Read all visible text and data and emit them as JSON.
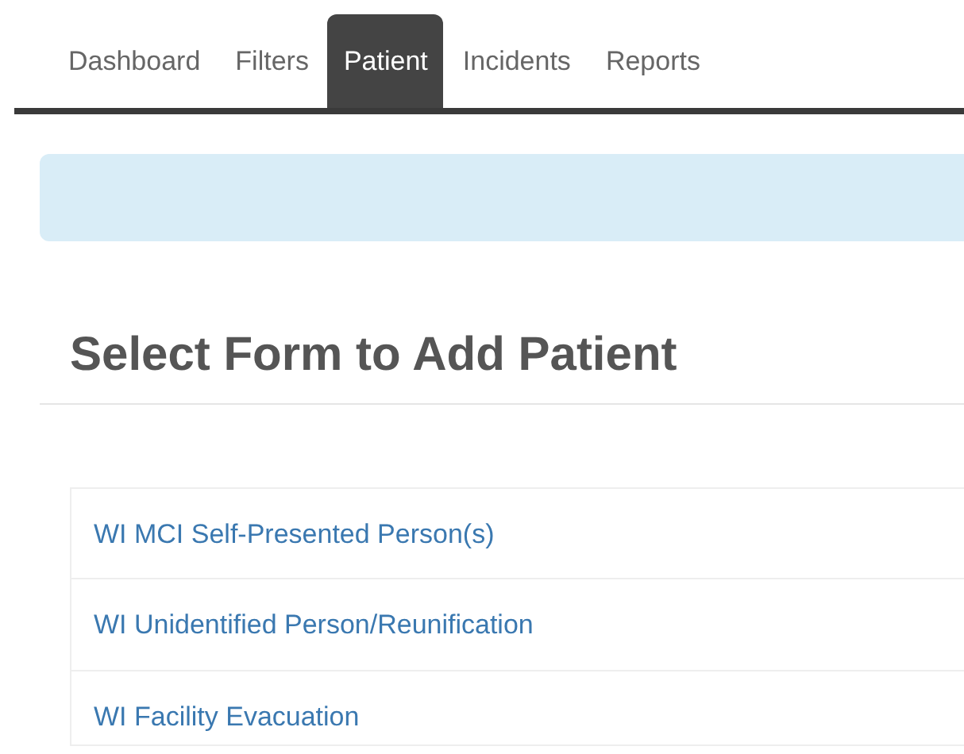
{
  "tabs": [
    {
      "label": "Dashboard",
      "selected": false
    },
    {
      "label": "Filters",
      "selected": false
    },
    {
      "label": "Patient",
      "selected": true
    },
    {
      "label": "Incidents",
      "selected": false
    },
    {
      "label": "Reports",
      "selected": false
    }
  ],
  "heading": "Select Form to Add Patient",
  "forms": [
    "WI MCI Self-Presented Person(s)",
    "WI Unidentified Person/Reunification",
    "WI Facility Evacuation"
  ]
}
